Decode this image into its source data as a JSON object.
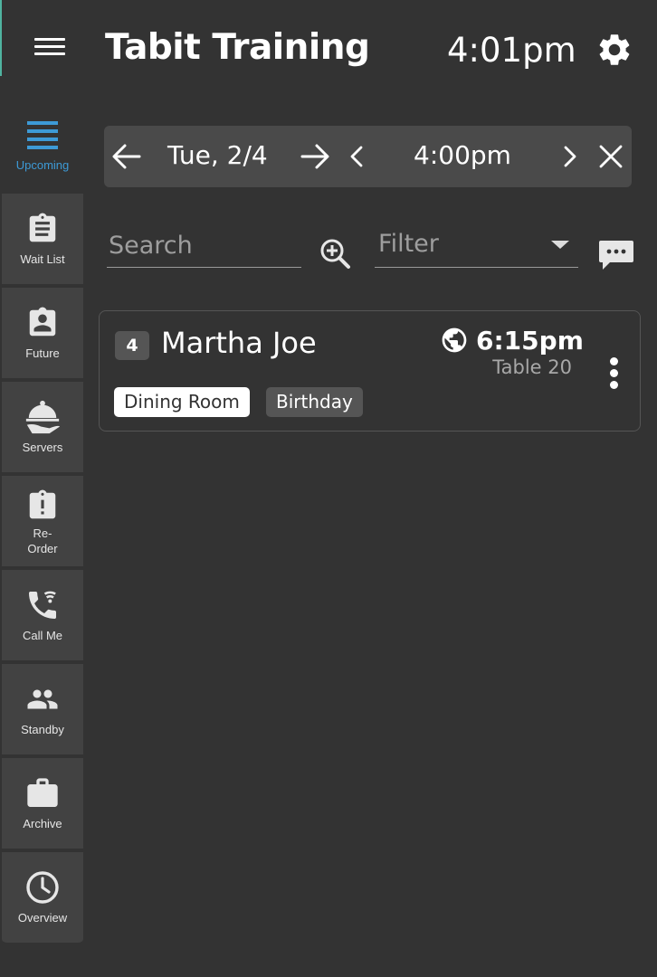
{
  "colors": {
    "background": "#333333",
    "panel": "#4a4a4a",
    "sidebar_item": "#424242",
    "active_accent": "#3d9ad6",
    "muted_text": "#9e9e9e"
  },
  "header": {
    "title": "Tabit Training",
    "clock": "4:01pm",
    "menu_icon": "hamburger-icon",
    "settings_icon": "gear-icon"
  },
  "sidebar": {
    "items": [
      {
        "label": "Upcoming",
        "icon": "list-icon",
        "active": true
      },
      {
        "label": "Wait List",
        "icon": "clipboard-icon",
        "active": false
      },
      {
        "label": "Future",
        "icon": "contact-badge-icon",
        "active": false
      },
      {
        "label": "Servers",
        "icon": "cloche-icon",
        "active": false
      },
      {
        "label": "Re-\nOrder",
        "icon": "clipboard-alert-icon",
        "active": false
      },
      {
        "label": "Call Me",
        "icon": "phone-wifi-icon",
        "active": false
      },
      {
        "label": "Standby",
        "icon": "people-icon",
        "active": false
      },
      {
        "label": "Archive",
        "icon": "briefcase-icon",
        "active": false
      },
      {
        "label": "Overview",
        "icon": "clock-icon",
        "active": false
      }
    ]
  },
  "datebar": {
    "date": "Tue, 2/4",
    "time": "4:00pm"
  },
  "search": {
    "placeholder": "Search",
    "value": ""
  },
  "filter": {
    "placeholder": "Filter"
  },
  "reservations": [
    {
      "party_size": "4",
      "name": "Martha Joe",
      "time": "6:15pm",
      "table": "Table 20",
      "source_icon": "globe-icon",
      "tags": [
        "Dining Room",
        "Birthday"
      ]
    }
  ]
}
